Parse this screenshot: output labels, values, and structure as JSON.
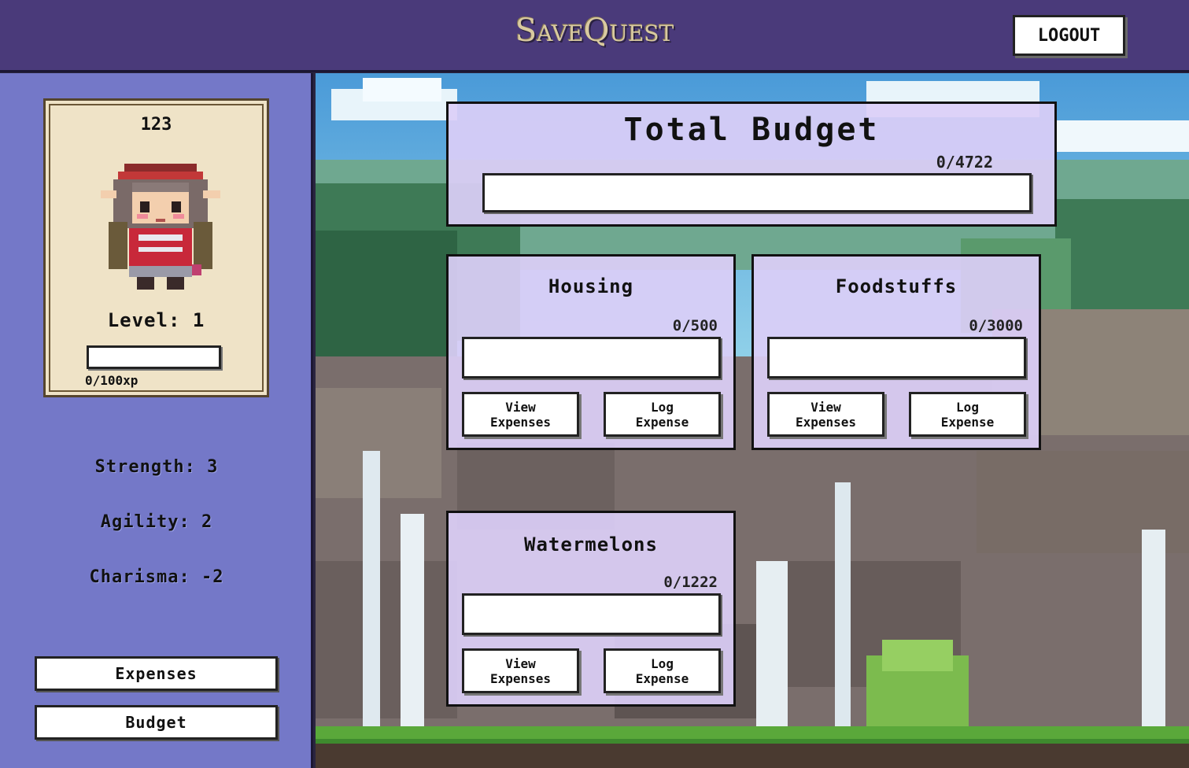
{
  "app": {
    "title": "SaveQuest",
    "logout_label": "LOGOUT"
  },
  "character": {
    "name": "123",
    "level_text": "Level: 1",
    "xp_text": "0/100xp",
    "xp_progress": 0,
    "stats": {
      "strength": "Strength: 3",
      "agility": "Agility: 2",
      "charisma": "Charisma: -2"
    }
  },
  "sidebar": {
    "expenses_label": "Expenses",
    "budget_label": "Budget"
  },
  "total_budget": {
    "title": "Total Budget",
    "amount": "0/4722",
    "progress": 0
  },
  "categories": [
    {
      "title": "Housing",
      "amount": "0/500",
      "progress": 0,
      "view_label": "View\nExpenses",
      "log_label": "Log\nExpense"
    },
    {
      "title": "Foodstuffs",
      "amount": "0/3000",
      "progress": 0,
      "view_label": "View\nExpenses",
      "log_label": "Log\nExpense"
    },
    {
      "title": "Watermelons",
      "amount": "0/1222",
      "progress": 0,
      "view_label": "View\nExpenses",
      "log_label": "Log\nExpense"
    }
  ],
  "colors": {
    "header": "#4a3a7a",
    "sidebar": "#7478c8",
    "panel": "#dbcef7",
    "card": "#efe3c7"
  }
}
